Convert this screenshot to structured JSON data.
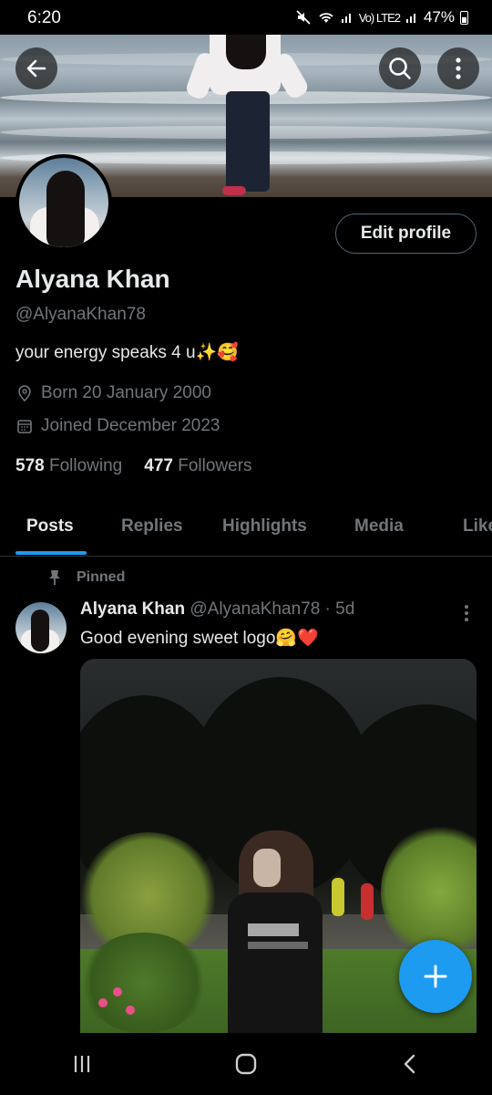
{
  "status_bar": {
    "time": "6:20",
    "network": "Vo) LTE2",
    "battery": "47%"
  },
  "profile": {
    "name": "Alyana Khan",
    "handle": "@AlyanaKhan78",
    "bio": "your energy speaks 4 u✨🥰",
    "born": "Born 20 January 2000",
    "joined": "Joined December 2023",
    "following_count": "578",
    "following_label": "Following",
    "followers_count": "477",
    "followers_label": "Followers",
    "edit_label": "Edit profile"
  },
  "tabs": [
    {
      "label": "Posts",
      "active": true
    },
    {
      "label": "Replies",
      "active": false
    },
    {
      "label": "Highlights",
      "active": false
    },
    {
      "label": "Media",
      "active": false
    },
    {
      "label": "Likes",
      "active": false
    }
  ],
  "pinned_post": {
    "pinned_label": "Pinned",
    "author": "Alyana Khan",
    "handle_time": "@AlyanaKhan78 · 5d",
    "text": "Good evening sweet logo🤗❤️"
  },
  "colors": {
    "accent": "#1d9bf0",
    "background": "#000000",
    "text": "#e7e9ea",
    "muted": "#71767b"
  },
  "icons": [
    "back-arrow-icon",
    "search-icon",
    "more-vertical-icon",
    "location-pin-icon",
    "calendar-icon",
    "pin-icon",
    "compose-plus-icon",
    "recents-icon",
    "home-icon",
    "back-icon"
  ]
}
